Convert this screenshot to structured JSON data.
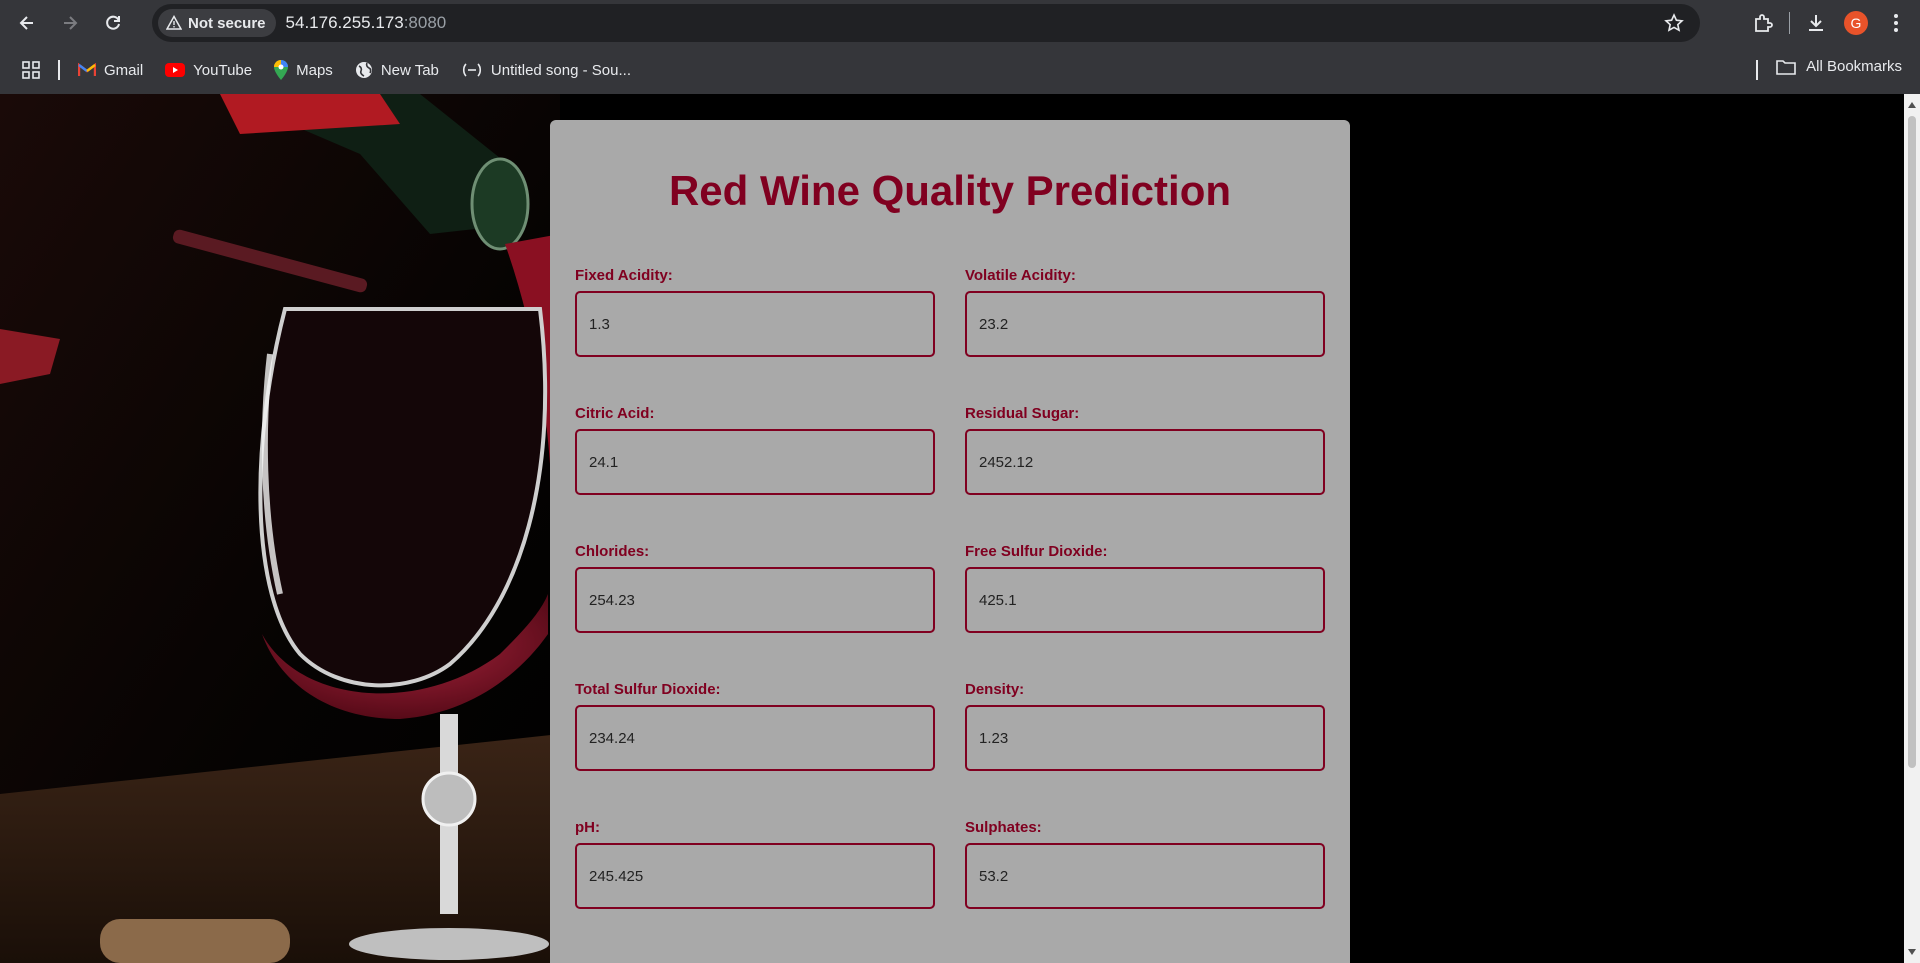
{
  "browser": {
    "security_label": "Not secure",
    "url_host": "54.176.255.173",
    "url_port": ":8080",
    "avatar_letter": "G"
  },
  "bookmarks": {
    "items": [
      {
        "label": "Gmail",
        "icon": "gmail-icon"
      },
      {
        "label": "YouTube",
        "icon": "youtube-icon"
      },
      {
        "label": "Maps",
        "icon": "maps-icon"
      },
      {
        "label": "New Tab",
        "icon": "globe-icon"
      },
      {
        "label": "Untitled song - Sou...",
        "icon": "soundtrap-icon"
      }
    ],
    "all_bookmarks_label": "All Bookmarks"
  },
  "page": {
    "title": "Red Wine Quality Prediction",
    "fields": [
      {
        "label": "Fixed Acidity:",
        "value": "1.3"
      },
      {
        "label": "Volatile Acidity:",
        "value": "23.2"
      },
      {
        "label": "Citric Acid:",
        "value": "24.1"
      },
      {
        "label": "Residual Sugar:",
        "value": "2452.12"
      },
      {
        "label": "Chlorides:",
        "value": "254.23"
      },
      {
        "label": "Free Sulfur Dioxide:",
        "value": "425.1"
      },
      {
        "label": "Total Sulfur Dioxide:",
        "value": "234.24"
      },
      {
        "label": "Density:",
        "value": "1.23"
      },
      {
        "label": "pH:",
        "value": "245.425"
      },
      {
        "label": "Sulphates:",
        "value": "53.2"
      }
    ]
  },
  "colors": {
    "accent": "#800020",
    "panel": "#a9a9a9",
    "background": "#000000"
  }
}
